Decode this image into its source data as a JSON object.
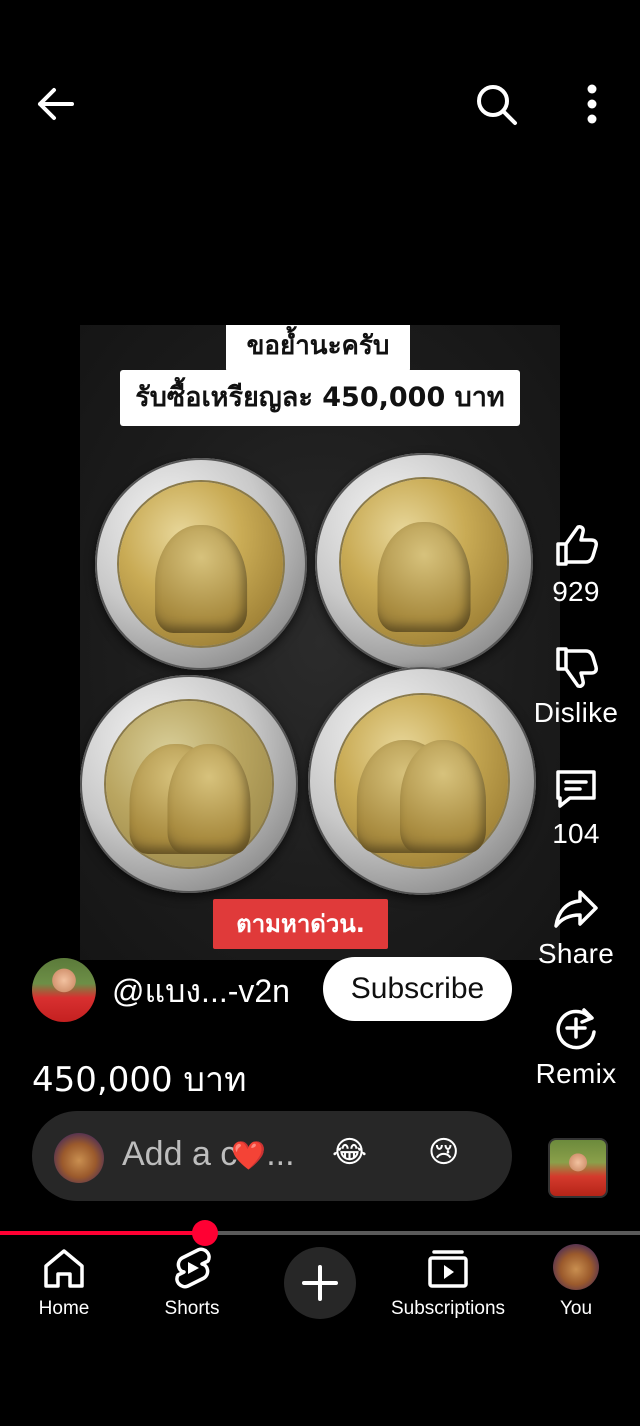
{
  "topbar": {
    "back_icon": "arrow-left-icon",
    "search_icon": "search-icon",
    "more_icon": "more-vertical-icon"
  },
  "video": {
    "caption_line1": "ขอย้ำนะครับ",
    "caption_line2": "รับซื้อเหรียญละ 450,000 บาท",
    "badge_text": "ตามหาด่วน."
  },
  "actions": {
    "like_count": "929",
    "dislike_label": "Dislike",
    "comment_count": "104",
    "share_label": "Share",
    "remix_label": "Remix"
  },
  "channel": {
    "name": "@แบง...-v2n",
    "subscribe_label": "Subscribe"
  },
  "video_title": "450,000 บาท",
  "comment_bar": {
    "placeholder": "Add a c",
    "ellipsis": "...",
    "emojis": [
      "❤️",
      "😂",
      "😢"
    ]
  },
  "progress": {
    "fraction": 0.32
  },
  "nav": {
    "items": [
      {
        "label": "Home",
        "icon": "home-icon"
      },
      {
        "label": "Shorts",
        "icon": "shorts-icon"
      },
      {
        "label": "",
        "icon": "plus-icon"
      },
      {
        "label": "Subscriptions",
        "icon": "subscriptions-icon"
      },
      {
        "label": "You",
        "icon": "avatar"
      }
    ]
  },
  "colors": {
    "accent": "#ff0033",
    "badge": "#e03a3a"
  }
}
